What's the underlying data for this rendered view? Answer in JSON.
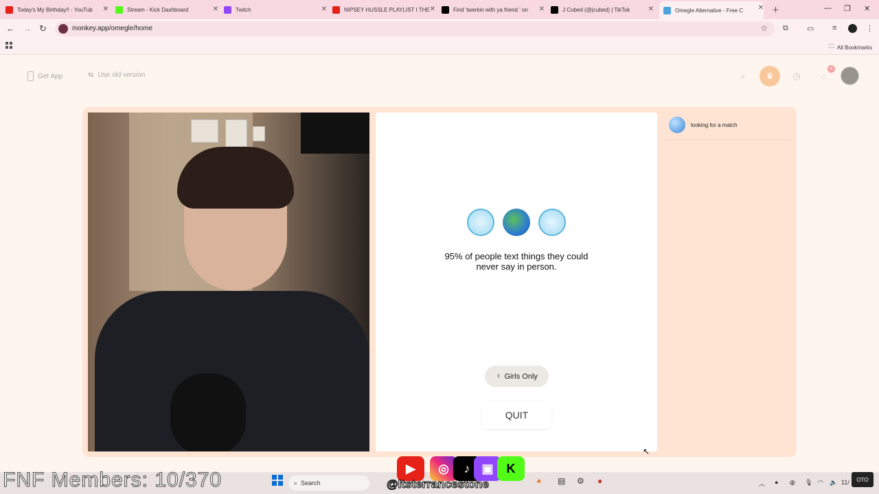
{
  "tabs": [
    {
      "label": "Today's My Birthday!! - YouTub",
      "icon": "youtube-icon",
      "color": "#e62117"
    },
    {
      "label": "Stream - Kick Dashboard",
      "icon": "kick-icon",
      "color": "#53fc18"
    },
    {
      "label": "Twitch",
      "icon": "twitch-icon",
      "color": "#9146ff"
    },
    {
      "label": "NIPSEY HUSSLE PLAYLIST I THE",
      "icon": "youtube-icon",
      "color": "#e62117"
    },
    {
      "label": "Find 'twerkin with ya friend ' on",
      "icon": "tiktok-icon",
      "color": "#000000"
    },
    {
      "label": "J Cubed (@jcubed) | TikTok",
      "icon": "tiktok-icon",
      "color": "#000000"
    },
    {
      "label": "Omegle Alternative - Free C",
      "icon": "omegle-icon",
      "color": "#4aa3df"
    }
  ],
  "address": {
    "url": "monkey.app/omegle/home"
  },
  "bookmarks": {
    "all_label": "All Bookmarks"
  },
  "topnav": {
    "get_app": "Get App",
    "old_version": "Use old version",
    "chat_badge": "4"
  },
  "match": {
    "message": "95% of people text things they could never say in person.",
    "girls_only": "Girls Only",
    "quit": "QUIT"
  },
  "sidebar": {
    "status": "looking for a match"
  },
  "taskbar": {
    "search": "Search",
    "time_partial": "11/"
  },
  "overlay": {
    "members": "FNF Members: 10/370",
    "handle": "@Itsterrancestone"
  }
}
